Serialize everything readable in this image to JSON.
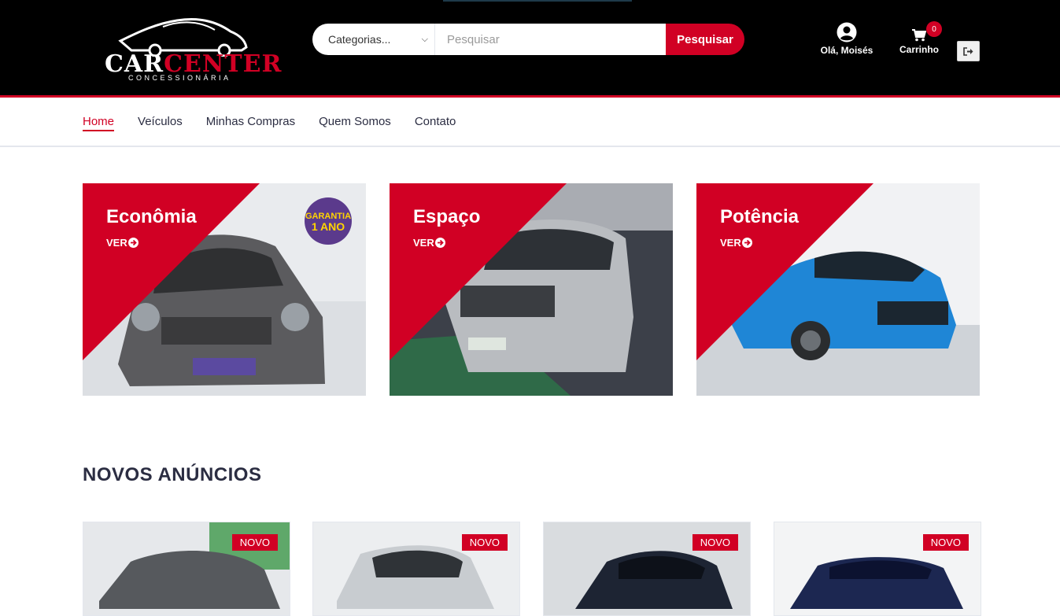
{
  "header": {
    "logo": {
      "brand_part1": "CAR",
      "brand_part2": "CENTER",
      "subtitle": "CONCESSIONÁRIA"
    },
    "search": {
      "category_value": "Categorias...",
      "placeholder": "Pesquisar",
      "button_label": "Pesquisar"
    },
    "account_label": "Olá, Moisés",
    "cart": {
      "label": "Carrinho",
      "count": "0"
    }
  },
  "nav": {
    "items": [
      {
        "label": "Home",
        "active": true
      },
      {
        "label": "Veículos"
      },
      {
        "label": "Minhas Compras"
      },
      {
        "label": "Quem Somos"
      },
      {
        "label": "Contato"
      }
    ]
  },
  "categories": [
    {
      "title": "Econômia",
      "cta": "VER"
    },
    {
      "title": "Espaço",
      "cta": "VER"
    },
    {
      "title": "Potência",
      "cta": "VER"
    }
  ],
  "section_title": "NOVOS ANÚNCIOS",
  "products": [
    {
      "badge": "NOVO"
    },
    {
      "badge": "NOVO"
    },
    {
      "badge": "NOVO"
    },
    {
      "badge": "NOVO"
    }
  ],
  "colors": {
    "accent": "#d10024",
    "header_bg": "#000000",
    "text_dark": "#2b2d42"
  }
}
